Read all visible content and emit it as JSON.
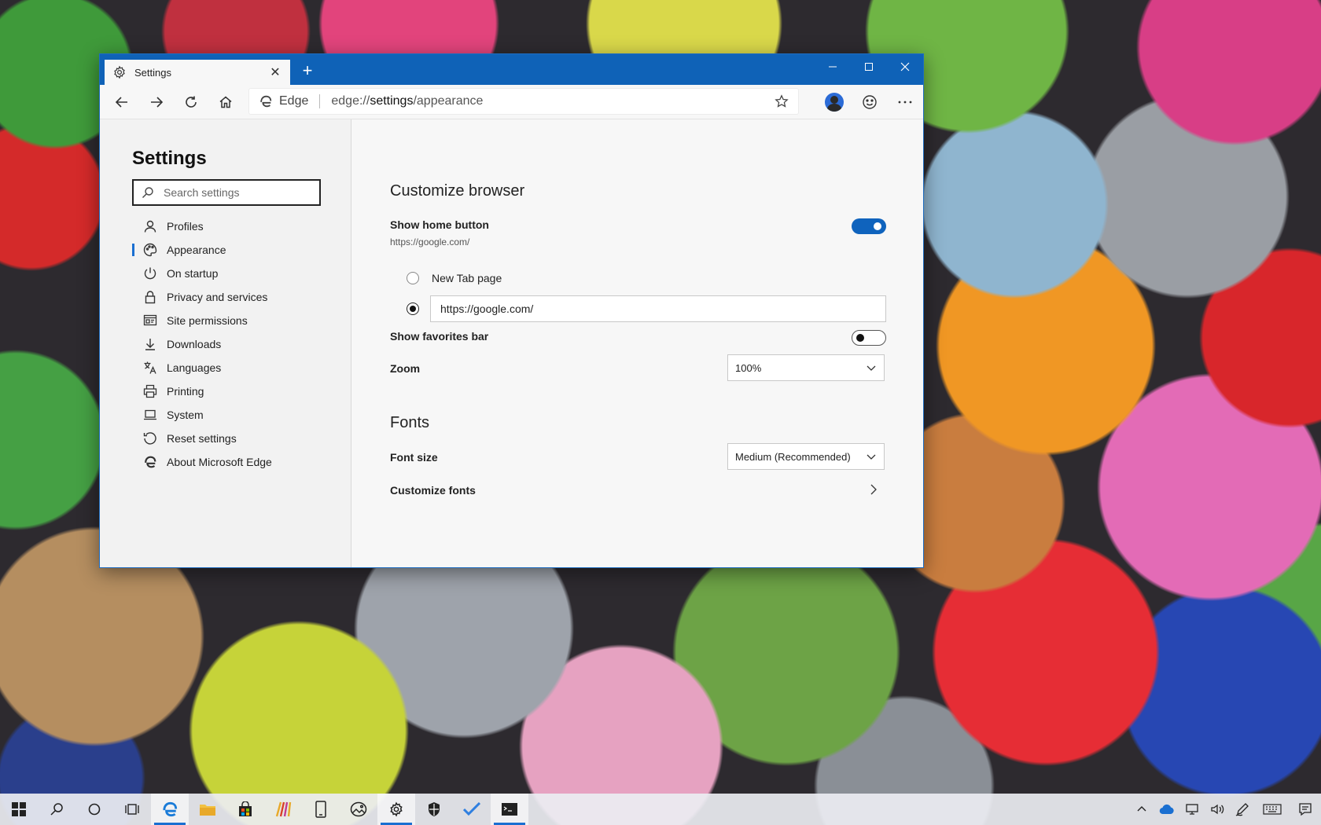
{
  "browser": {
    "tab_title": "Settings",
    "new_tab_symbol": "+",
    "address_site": "Edge",
    "url_prefix": "edge://",
    "url_host": "settings",
    "url_path": "/appearance"
  },
  "sidebar": {
    "title": "Settings",
    "search_placeholder": "Search settings",
    "items": [
      {
        "label": "Profiles",
        "icon": "person-icon"
      },
      {
        "label": "Appearance",
        "icon": "palette-icon"
      },
      {
        "label": "On startup",
        "icon": "power-icon"
      },
      {
        "label": "Privacy and services",
        "icon": "lock-icon"
      },
      {
        "label": "Site permissions",
        "icon": "site-permissions-icon"
      },
      {
        "label": "Downloads",
        "icon": "download-icon"
      },
      {
        "label": "Languages",
        "icon": "language-icon"
      },
      {
        "label": "Printing",
        "icon": "printer-icon"
      },
      {
        "label": "System",
        "icon": "laptop-icon"
      },
      {
        "label": "Reset settings",
        "icon": "reset-icon"
      },
      {
        "label": "About Microsoft Edge",
        "icon": "edge-logo-icon"
      }
    ],
    "active_index": 1
  },
  "main": {
    "customize_title": "Customize browser",
    "home_button_label": "Show home button",
    "home_button_url": "https://google.com/",
    "home_button_on": true,
    "radio_new_tab_label": "New Tab page",
    "radio_url_value": "https://google.com/",
    "favorites_bar_label": "Show favorites bar",
    "favorites_bar_on": false,
    "zoom_label": "Zoom",
    "zoom_value": "100%",
    "fonts_title": "Fonts",
    "font_size_label": "Font size",
    "font_size_value": "Medium (Recommended)",
    "customize_fonts_label": "Customize fonts"
  },
  "colors": {
    "titlebar": "#0f62b7",
    "accent": "#0f63bd"
  }
}
